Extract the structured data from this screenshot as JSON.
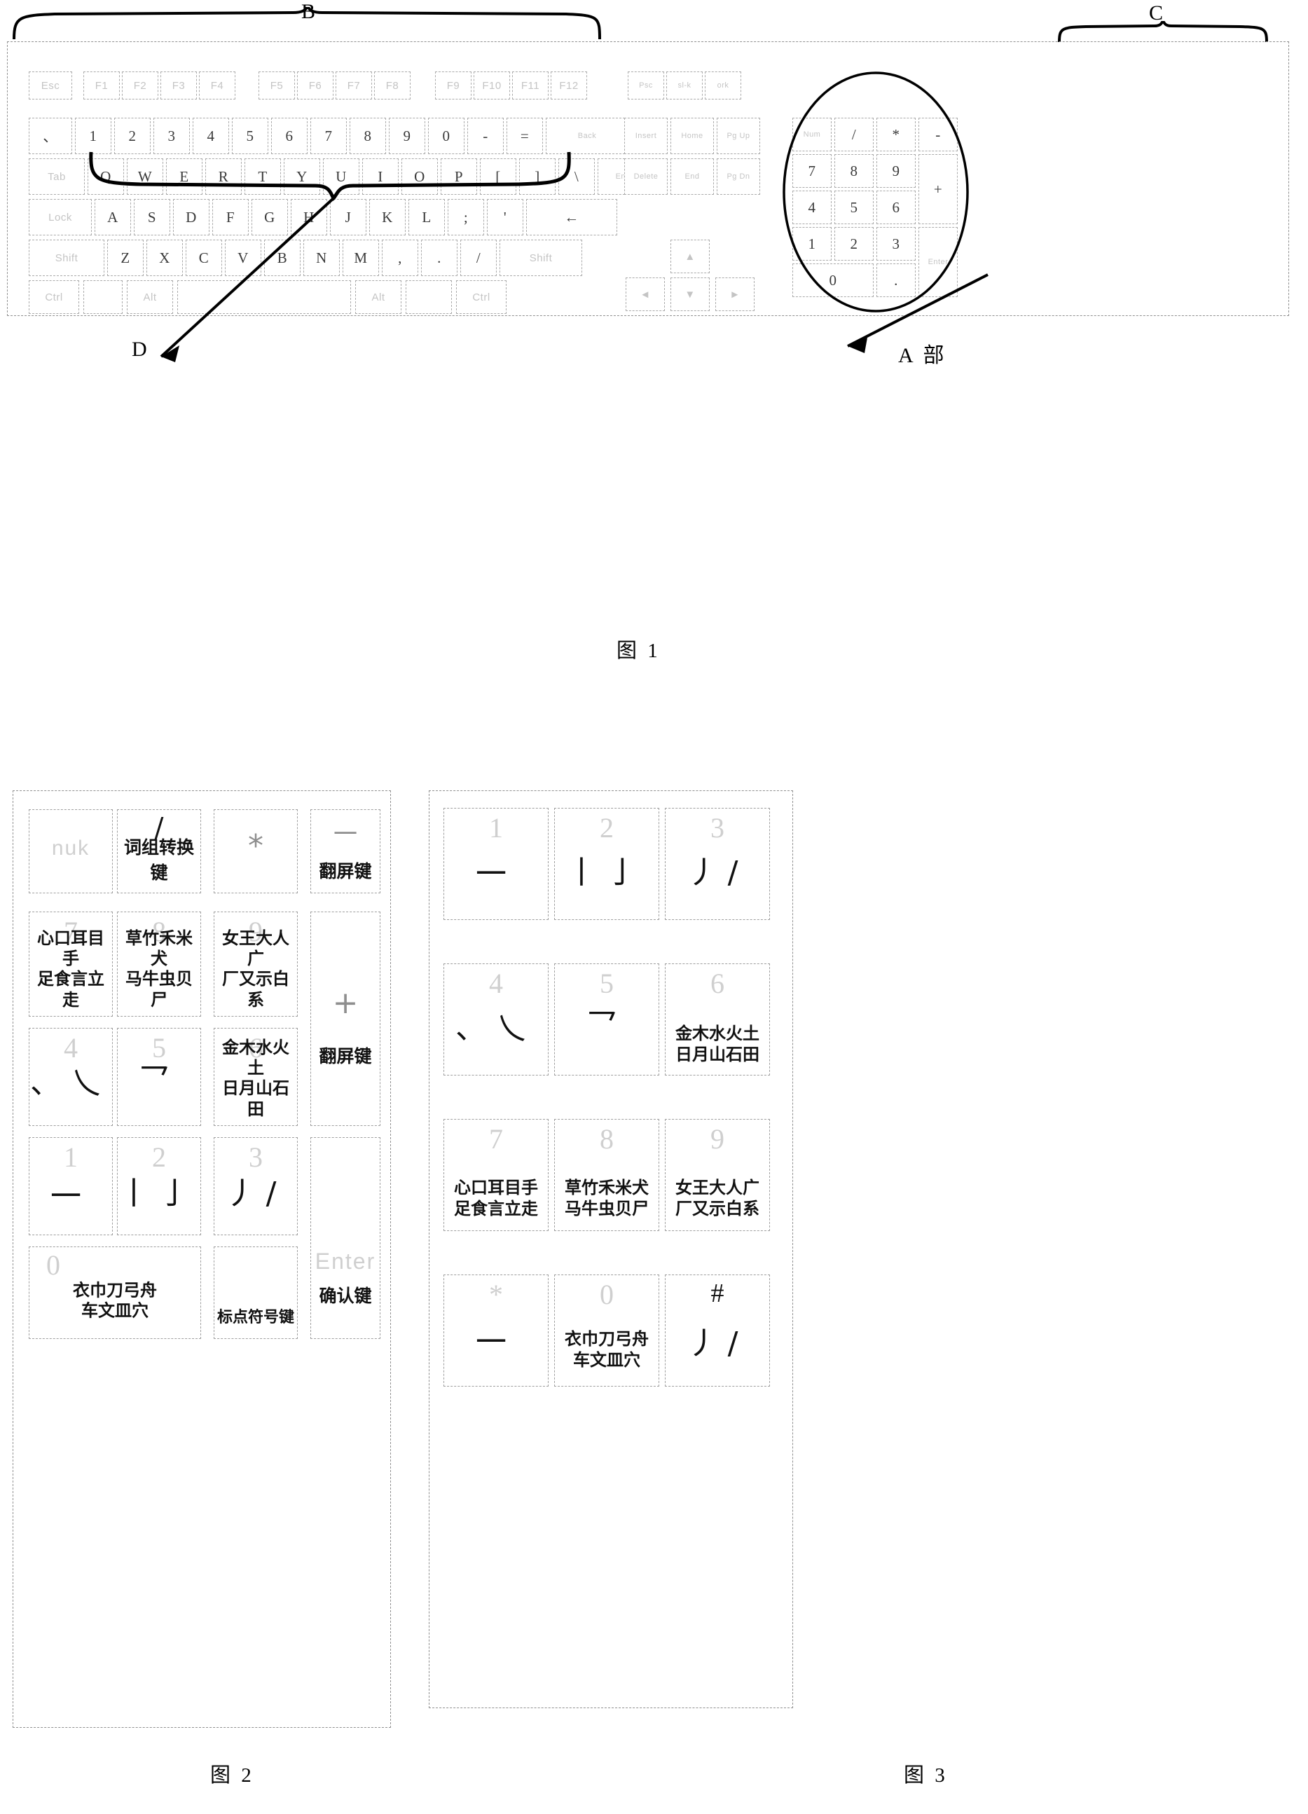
{
  "figures": {
    "fig1": {
      "caption": "图 1",
      "brace_b": "B",
      "brace_c": "C",
      "callout_d": "D",
      "callout_a": "A 部",
      "function_row": [
        "Esc",
        "F1",
        "F2",
        "F3",
        "F4",
        "F5",
        "F6",
        "F7",
        "F8",
        "F9",
        "F10",
        "F11",
        "F12",
        "Psc",
        "sl-k",
        "ork"
      ],
      "number_row": [
        "、",
        "1",
        "2",
        "3",
        "4",
        "5",
        "6",
        "7",
        "8",
        "9",
        "0",
        "-",
        "=",
        "Back"
      ],
      "qwerty_row": [
        "Tab",
        "Q",
        "W",
        "E",
        "R",
        "T",
        "Y",
        "U",
        "I",
        "O",
        "P",
        "[",
        "]",
        "\\",
        "Enter"
      ],
      "home_row": [
        "Lock",
        "A",
        "S",
        "D",
        "F",
        "G",
        "H",
        "J",
        "K",
        "L",
        ";",
        "'",
        "←"
      ],
      "shift_row": [
        "Shift",
        "Z",
        "X",
        "C",
        "V",
        "B",
        "N",
        "M",
        ",",
        ".",
        "/",
        "Shift"
      ],
      "bottom_row": [
        "Ctrl",
        "",
        "Alt",
        "",
        "Alt",
        "",
        "Ctrl"
      ],
      "nav_cluster": [
        "Insert",
        "Home",
        "Pg Up",
        "Delete",
        "End",
        "Pg Dn"
      ],
      "numpad": [
        "Num",
        "/",
        "*",
        "-",
        "7",
        "8",
        "9",
        "+",
        "4",
        "5",
        "6",
        "1",
        "2",
        "3",
        "Enter",
        "0",
        "."
      ],
      "arrows": [
        "▲",
        "◄",
        "▼",
        "►"
      ]
    },
    "fig2": {
      "caption": "图 2",
      "keys": [
        {
          "id": "numlock",
          "num": "",
          "ghost": "nuk",
          "stroke": "",
          "cn": "",
          "label": ""
        },
        {
          "id": "slash",
          "num": "",
          "ghost": "",
          "stroke": "/",
          "cn": "",
          "label": "词组转换键"
        },
        {
          "id": "star",
          "num": "",
          "ghost": "",
          "stroke": "*",
          "cn": "",
          "label": ""
        },
        {
          "id": "minus",
          "num": "",
          "ghost": "",
          "stroke": "一",
          "cn": "",
          "label": "翻屏键"
        },
        {
          "id": "k7",
          "num": "7",
          "ghost": "",
          "stroke": "",
          "cn": "心口耳目手\n足食言立走",
          "label": ""
        },
        {
          "id": "k8",
          "num": "8",
          "ghost": "",
          "stroke": "",
          "cn": "草竹禾米犬\n马牛虫贝尸",
          "label": ""
        },
        {
          "id": "k9",
          "num": "9",
          "ghost": "",
          "stroke": "",
          "cn": "女王大人广\n厂又示白系",
          "label": ""
        },
        {
          "id": "plus",
          "num": "",
          "ghost": "",
          "stroke": "+",
          "cn": "",
          "label": "翻屏键"
        },
        {
          "id": "k4",
          "num": "4",
          "ghost": "",
          "stroke": "、乀",
          "cn": "",
          "label": ""
        },
        {
          "id": "k5",
          "num": "5",
          "ghost": "",
          "stroke": "乛",
          "cn": "",
          "label": ""
        },
        {
          "id": "k6",
          "num": "6",
          "ghost": "",
          "stroke": "",
          "cn": "金木水火土\n日月山石田",
          "label": ""
        },
        {
          "id": "k1",
          "num": "1",
          "ghost": "",
          "stroke": "一",
          "cn": "",
          "label": ""
        },
        {
          "id": "k2",
          "num": "2",
          "ghost": "",
          "stroke": "丨亅",
          "cn": "",
          "label": ""
        },
        {
          "id": "k3",
          "num": "3",
          "ghost": "",
          "stroke": "丿/",
          "cn": "",
          "label": ""
        },
        {
          "id": "enter",
          "num": "",
          "ghost": "Enter",
          "stroke": "",
          "cn": "",
          "label": "确认键"
        },
        {
          "id": "k0",
          "num": "0",
          "ghost": "",
          "stroke": "",
          "cn": "衣巾刀弓舟\n车文皿穴",
          "label": ""
        },
        {
          "id": "dot",
          "num": "",
          "ghost": "",
          "stroke": "",
          "cn": "",
          "label": "标点符号键"
        }
      ]
    },
    "fig3": {
      "caption": "图 3",
      "keys": [
        {
          "id": "k1",
          "num": "1",
          "stroke": "一",
          "cn": ""
        },
        {
          "id": "k2",
          "num": "2",
          "stroke": "丨亅",
          "cn": ""
        },
        {
          "id": "k3",
          "num": "3",
          "stroke": "丿/",
          "cn": ""
        },
        {
          "id": "k4",
          "num": "4",
          "stroke": "、乀",
          "cn": ""
        },
        {
          "id": "k5",
          "num": "5",
          "stroke": "乛",
          "cn": ""
        },
        {
          "id": "k6",
          "num": "6",
          "stroke": "",
          "cn": "金木水火土\n日月山石田"
        },
        {
          "id": "k7",
          "num": "7",
          "stroke": "",
          "cn": "心口耳目手\n足食言立走"
        },
        {
          "id": "k8",
          "num": "8",
          "stroke": "",
          "cn": "草竹禾米犬\n马牛虫贝尸"
        },
        {
          "id": "k9",
          "num": "9",
          "stroke": "",
          "cn": "女王大人广\n厂又示白系"
        },
        {
          "id": "star",
          "num": "*",
          "stroke": "一",
          "cn": ""
        },
        {
          "id": "k0",
          "num": "0",
          "stroke": "",
          "cn": "衣巾刀弓舟\n车文皿穴"
        },
        {
          "id": "hash",
          "num": "#",
          "stroke": "丿/",
          "cn": ""
        }
      ]
    }
  },
  "colors": {
    "ink": "#111111",
    "ghost": "#c9c9c9",
    "rule": "#9a9a9a"
  }
}
